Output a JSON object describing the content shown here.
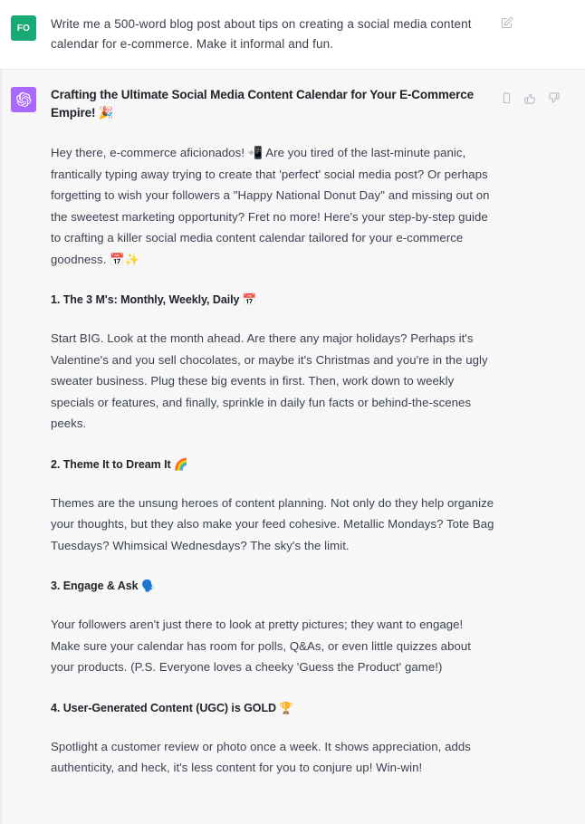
{
  "theme": {
    "user_bg": "#ffffff",
    "assistant_bg": "#f7f7f8",
    "user_avatar_bg": "#19a974",
    "assistant_avatar_bg": "#ab68ff",
    "body_text": "#3b4150",
    "heading_text": "#22242b",
    "icon_color": "#b4b7c4"
  },
  "user_message": {
    "avatar_initials": "FO",
    "text": "Write me a 500-word blog post about tips on creating a social media content calendar for e-commerce. Make it informal and fun.",
    "edit_icon": "edit-pencil-square-icon"
  },
  "assistant_message": {
    "avatar_icon": "openai-logo-icon",
    "actions": [
      {
        "name": "copy-icon",
        "label": "Copy"
      },
      {
        "name": "thumbs-up-icon",
        "label": "Good response"
      },
      {
        "name": "thumbs-down-icon",
        "label": "Bad response"
      }
    ],
    "title": "Crafting the Ultimate Social Media Content Calendar for Your E-Commerce Empire! 🎉",
    "intro": "Hey there, e-commerce aficionados! 📲 Are you tired of the last-minute panic, frantically typing away trying to create that 'perfect' social media post? Or perhaps forgetting to wish your followers a \"Happy National Donut Day\" and missing out on the sweetest marketing opportunity? Fret no more! Here's your step-by-step guide to crafting a killer social media content calendar tailored for your e-commerce goodness. 📅✨",
    "sections": [
      {
        "heading": "1. The 3 M's: Monthly, Weekly, Daily 📅",
        "paragraph": "Start BIG. Look at the month ahead. Are there any major holidays? Perhaps it's Valentine's and you sell chocolates, or maybe it's Christmas and you're in the ugly sweater business. Plug these big events in first. Then, work down to weekly specials or features, and finally, sprinkle in daily fun facts or behind-the-scenes peeks."
      },
      {
        "heading": "2. Theme It to Dream It 🌈",
        "paragraph": "Themes are the unsung heroes of content planning. Not only do they help organize your thoughts, but they also make your feed cohesive. Metallic Mondays? Tote Bag Tuesdays? Whimsical Wednesdays? The sky's the limit."
      },
      {
        "heading": "3. Engage & Ask 🗣️",
        "paragraph": "Your followers aren't just there to look at pretty pictures; they want to engage! Make sure your calendar has room for polls, Q&As, or even little quizzes about your products. (P.S. Everyone loves a cheeky 'Guess the Product' game!)"
      },
      {
        "heading": "4. User-Generated Content (UGC) is GOLD 🏆",
        "paragraph": "Spotlight a customer review or photo once a week. It shows appreciation, adds authenticity, and heck, it's less content for you to conjure up! Win-win!"
      }
    ]
  }
}
